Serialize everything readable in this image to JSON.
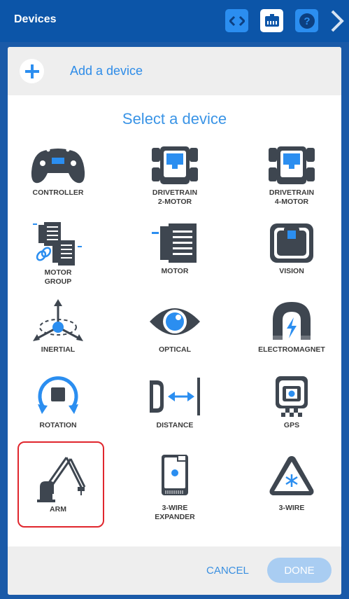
{
  "header": {
    "title": "Devices",
    "icons": [
      "code-icon",
      "device-port-icon",
      "help-icon",
      "chevron-right-icon"
    ]
  },
  "add_device": {
    "label": "Add a device",
    "icon": "plus-icon"
  },
  "select_title": "Select a device",
  "devices": [
    {
      "line1": "CONTROLLER",
      "line2": "",
      "icon": "controller-icon"
    },
    {
      "line1": "DRIVETRAIN",
      "line2": "2-MOTOR",
      "icon": "drivetrain-2-motor-icon"
    },
    {
      "line1": "DRIVETRAIN",
      "line2": "4-MOTOR",
      "icon": "drivetrain-4-motor-icon"
    },
    {
      "line1": "MOTOR",
      "line2": "GROUP",
      "icon": "motor-group-icon"
    },
    {
      "line1": "MOTOR",
      "line2": "",
      "icon": "motor-icon"
    },
    {
      "line1": "VISION",
      "line2": "",
      "icon": "vision-icon"
    },
    {
      "line1": "INERTIAL",
      "line2": "",
      "icon": "inertial-icon"
    },
    {
      "line1": "OPTICAL",
      "line2": "",
      "icon": "optical-icon"
    },
    {
      "line1": "ELECTROMAGNET",
      "line2": "",
      "icon": "electromagnet-icon"
    },
    {
      "line1": "ROTATION",
      "line2": "",
      "icon": "rotation-icon"
    },
    {
      "line1": "DISTANCE",
      "line2": "",
      "icon": "distance-icon"
    },
    {
      "line1": "GPS",
      "line2": "",
      "icon": "gps-icon"
    },
    {
      "line1": "ARM",
      "line2": "",
      "icon": "arm-icon"
    },
    {
      "line1": "3-WIRE",
      "line2": "EXPANDER",
      "icon": "3-wire-expander-icon"
    },
    {
      "line1": "3-WIRE",
      "line2": "",
      "icon": "3-wire-icon"
    }
  ],
  "footer": {
    "cancel_label": "CANCEL",
    "done_label": "DONE"
  },
  "colors": {
    "header": "#0c55a8",
    "accent": "#2b8ef0",
    "icon_dark": "#3e4650",
    "highlight": "#e0262d"
  }
}
